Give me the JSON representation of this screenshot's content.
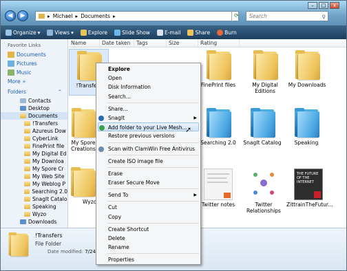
{
  "address": {
    "path": [
      "Michael",
      "Documents"
    ],
    "search_placeholder": "Search"
  },
  "toolbar": [
    "Organize",
    "Views",
    "Explore",
    "Slide Show",
    "E-mail",
    "Share",
    "Burn"
  ],
  "favorites": {
    "header": "Favorite Links",
    "items": [
      "Documents",
      "Pictures",
      "Music"
    ],
    "more": "More"
  },
  "folders": {
    "header": "Folders",
    "items": [
      "Contacts",
      "Desktop",
      "Documents",
      "!Transfers",
      "Azureus Dow",
      "CyberLink",
      "FinePrint file",
      "My Digital Ed",
      "My Downloa",
      "My Spore Cr",
      "My Web Site",
      "My Weblog P",
      "Searching 2.0",
      "SnagIt Catalo",
      "Speaking",
      "Wyzo",
      "Downloads"
    ]
  },
  "columns": [
    "Name",
    "Date taken",
    "Tags",
    "Size",
    "Rating"
  ],
  "content_items": [
    {
      "label": "!Transfers"
    },
    {
      "label": "FinePrint files"
    },
    {
      "label": "My Digital Editions"
    },
    {
      "label": "My Downloads"
    },
    {
      "label": "My Spore Creations"
    },
    {
      "label": "Searching 2.0"
    },
    {
      "label": "SnagIt Catalog"
    },
    {
      "label": "Speaking"
    },
    {
      "label": "Wyzo"
    },
    {
      "label": "Twitter notes"
    },
    {
      "label": "Twitter Relationships"
    },
    {
      "label": "ZittrainTheFutur..."
    }
  ],
  "details": {
    "name": "!Transfers",
    "type": "File Folder",
    "modified_label": "Date modified:",
    "modified_value": "7/24/"
  },
  "context_menu": [
    "Explore",
    "Open",
    "Disk Information",
    "Search...",
    "Share...",
    "SnagIt",
    "Add folder to your Live Mesh...",
    "Restore previous versions",
    "Scan with ClamWin Free Antivirus",
    "Create ISO image file",
    "Erase",
    "Eraser Secure Move",
    "Send To",
    "Cut",
    "Copy",
    "Create Shortcut",
    "Delete",
    "Rename",
    "Properties"
  ],
  "thumb_text": {
    "future_title": "THE FUTURE OF THE INTERNET"
  }
}
